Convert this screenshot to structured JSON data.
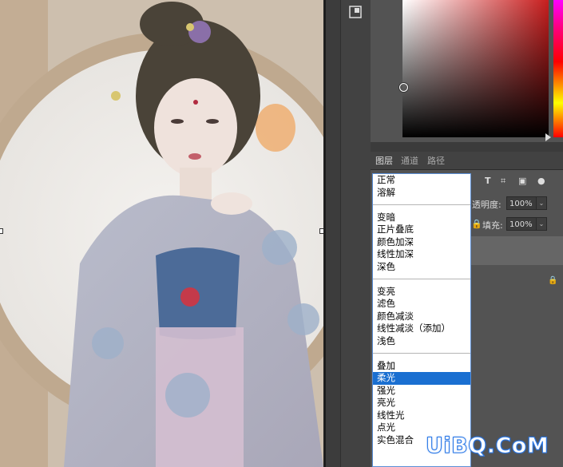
{
  "tabs": [
    {
      "label": "图层",
      "active": true
    },
    {
      "label": "通道",
      "active": false
    },
    {
      "label": "路径",
      "active": false
    }
  ],
  "opacity": {
    "label": "透明度:",
    "value": "100%"
  },
  "fill": {
    "label": "填充:",
    "value": "100%"
  },
  "blend_modes": {
    "selected": "柔光",
    "groups": [
      [
        "正常",
        "溶解"
      ],
      [
        "变暗",
        "正片叠底",
        "颜色加深",
        "线性加深",
        "深色"
      ],
      [
        "变亮",
        "滤色",
        "颜色减淡",
        "线性减淡（添加）",
        "浅色"
      ],
      [
        "叠加",
        "柔光",
        "强光",
        "亮光",
        "线性光",
        "点光",
        "实色混合"
      ]
    ]
  },
  "watermark": "UiBQ.CoM",
  "colors": {
    "selection_blue": "#1a6fd1",
    "panel_bg": "#535353",
    "dropdown_border": "#5b8fd6"
  },
  "icons": {
    "filter_icons": [
      "type-t-icon",
      "transform-icon",
      "smart-object-icon",
      "circle-toggle-icon"
    ],
    "lock": "lock-icon"
  }
}
